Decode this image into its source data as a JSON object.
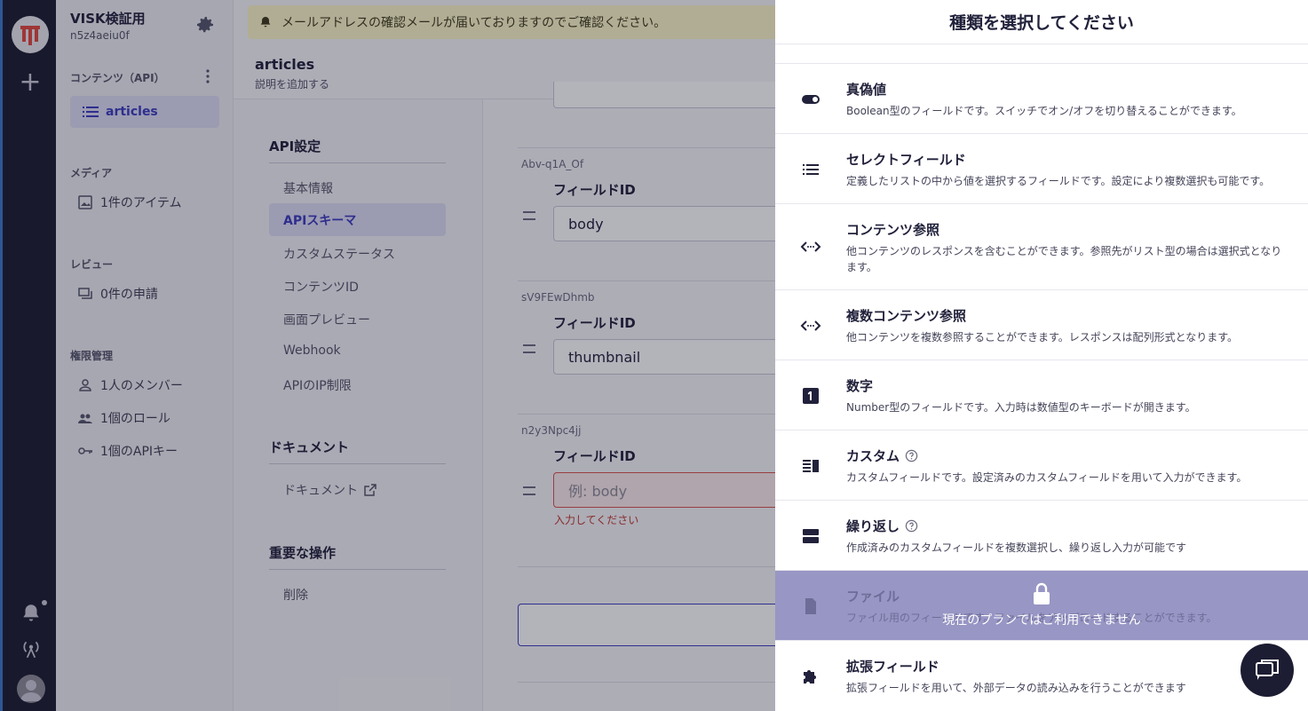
{
  "service": {
    "name": "VISK検証用",
    "id": "n5z4aeiu0f"
  },
  "sidebar": {
    "contents_section": "コンテンツ（API）",
    "active_api": "articles",
    "media_section": "メディア",
    "media_item": "1件のアイテム",
    "review_section": "レビュー",
    "review_item": "0件の申請",
    "permission_section": "権限管理",
    "members_item": "1人のメンバー",
    "roles_item": "1個のロール",
    "apikeys_item": "1個のAPIキー"
  },
  "banner": {
    "text": "メールアドレスの確認メールが届いておりますのでご確認ください。"
  },
  "page": {
    "title": "articles",
    "description": "説明を追加する"
  },
  "settings_nav": {
    "api_heading": "API設定",
    "items": [
      "基本情報",
      "APIスキーマ",
      "カスタムステータス",
      "コンテンツID",
      "画面プレビュー",
      "Webhook",
      "APIのIP制限"
    ],
    "doc_heading": "ドキュメント",
    "doc_item": "ドキュメント",
    "danger_heading": "重要な操作",
    "delete_item": "削除"
  },
  "fields": [
    {
      "code": "Abv-q1A_Of",
      "label": "フィールドID",
      "value": ""
    },
    {
      "code": "sV9FEwDhmb",
      "label": "フィールドID",
      "value": ""
    },
    {
      "code": "n2y3Npc4jj",
      "label": "フィールドID",
      "placeholder": "例: body",
      "error": "入力してください"
    }
  ],
  "field_values": [
    "body",
    "thumbnail"
  ],
  "drawer": {
    "title": "種類を選択してください",
    "options": [
      {
        "name": "真偽値",
        "icon": "toggle-icon",
        "desc": "Boolean型のフィールドです。スイッチでオン/オフを切り替えることができます。"
      },
      {
        "name": "セレクトフィールド",
        "icon": "list-icon",
        "desc": "定義したリストの中から値を選択するフィールドです。設定により複数選択も可能です。"
      },
      {
        "name": "コンテンツ参照",
        "icon": "reference-icon",
        "desc": "他コンテンツのレスポンスを含むことができます。参照先がリスト型の場合は選択式となります。"
      },
      {
        "name": "複数コンテンツ参照",
        "icon": "multi-reference-icon",
        "desc": "他コンテンツを複数参照することができます。レスポンスは配列形式となります。"
      },
      {
        "name": "数字",
        "icon": "number-icon",
        "desc": "Number型のフィールドです。入力時は数値型のキーボードが開きます。"
      },
      {
        "name": "カスタム",
        "icon": "custom-icon",
        "desc": "カスタムフィールドです。設定済みのカスタムフィールドを用いて入力ができます。"
      },
      {
        "name": "繰り返し",
        "icon": "repeat-icon",
        "desc": "作成済みのカスタムフィールドを複数選択し、繰り返し入力が可能です"
      },
      {
        "name": "ファイル",
        "icon": "file-icon",
        "desc": "ファイル用のフィールドです。ファイルをアップロードすることができます。"
      },
      {
        "name": "拡張フィールド",
        "icon": "puzzle-icon",
        "desc": "拡張フィールドを用いて、外部データの読み込みを行うことができます"
      }
    ],
    "locked_message": "現在のプランではご利用できません"
  }
}
